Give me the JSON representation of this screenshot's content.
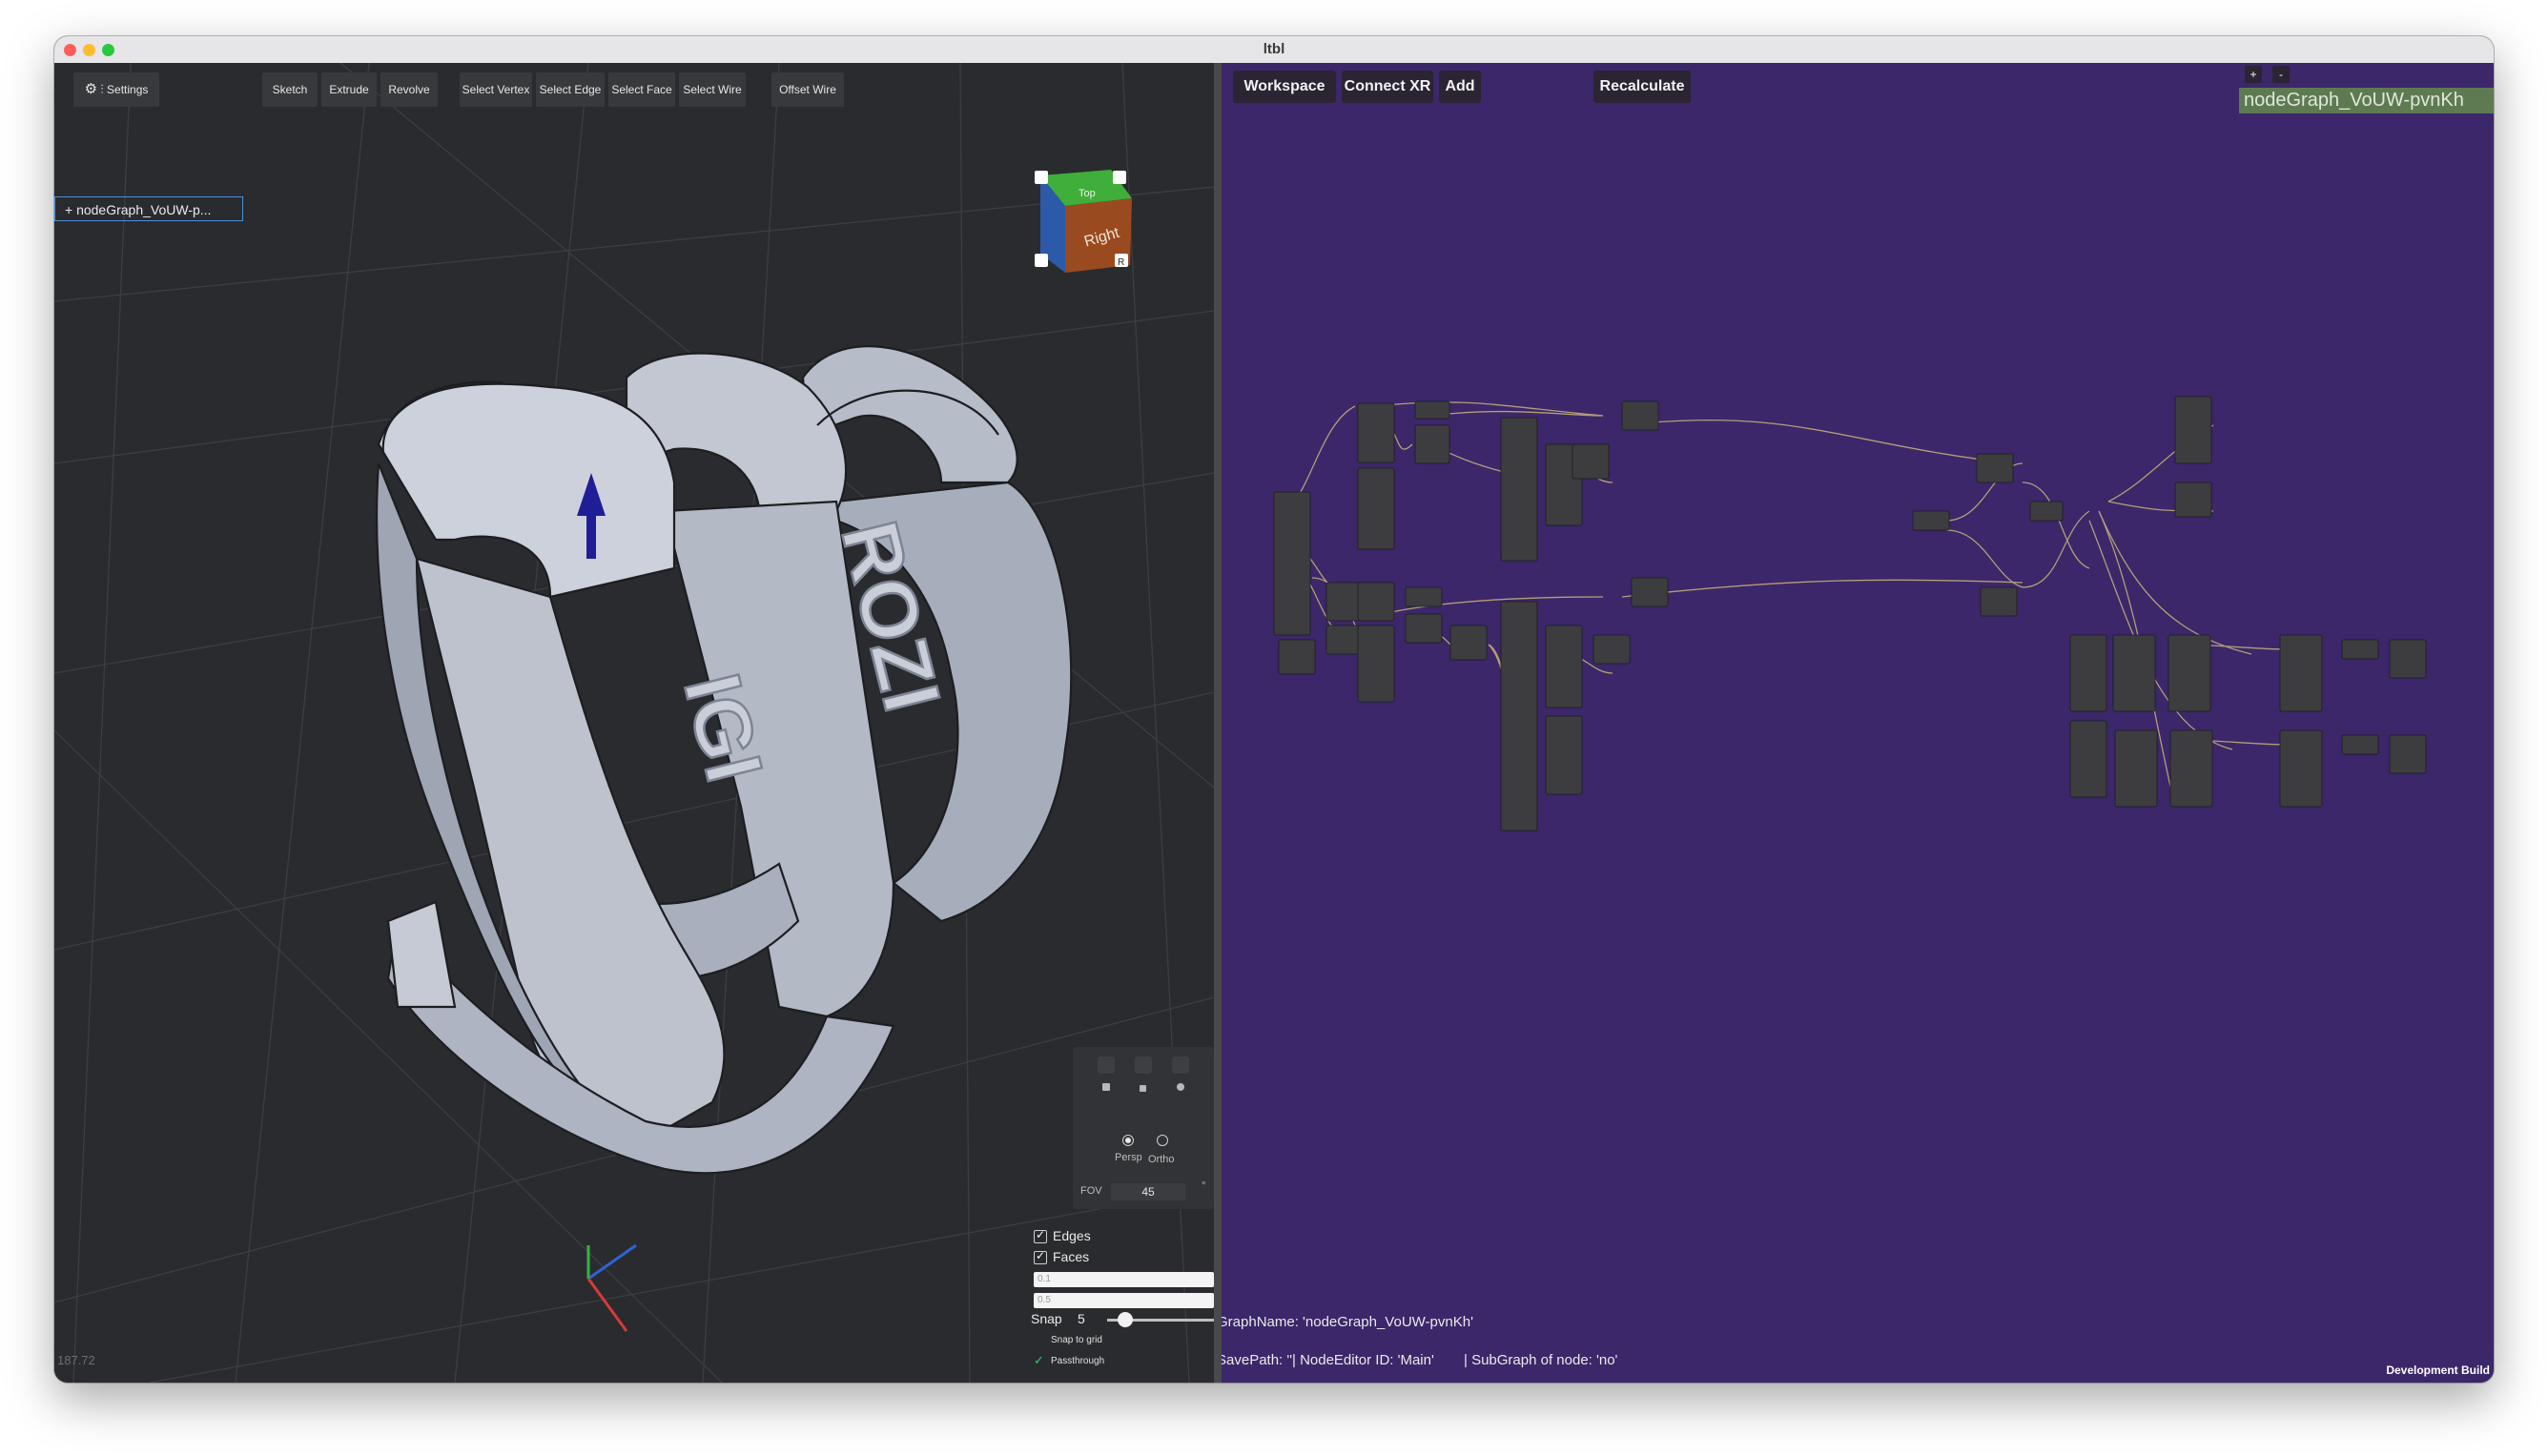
{
  "window": {
    "title": "ltbl"
  },
  "viewport": {
    "toolbar": {
      "settings": "Settings",
      "sketch": "Sketch",
      "extrude": "Extrude",
      "revolve": "Revolve",
      "select_vertex": "Select Vertex",
      "select_edge": "Select Edge",
      "select_face": "Select Face",
      "select_wire": "Select Wire",
      "offset_wire": "Offset Wire"
    },
    "node_tab": "+  nodeGraph_VoUW-p...",
    "view_cube": {
      "top": "Top",
      "right": "Right",
      "corner": "R"
    },
    "model_text": {
      "left": "IGI",
      "right": "ROZI"
    },
    "coordinate": "187.72",
    "camera": {
      "persp": "Persp",
      "ortho": "Ortho",
      "fov_label": "FOV",
      "fov_value": "45",
      "fov_unit": "°",
      "mode": "Persp"
    },
    "display": {
      "edges_label": "Edges",
      "edges": true,
      "faces_label": "Faces",
      "faces": true,
      "field1": "0.1",
      "field2": "0.5",
      "snap_label": "Snap",
      "snap_value": "5",
      "snap_slider": 0.1,
      "snap_to_grid_label": "Snap to grid",
      "snap_to_grid": false,
      "passthrough_label": "Passthrough",
      "passthrough": true
    }
  },
  "node_editor": {
    "buttons": {
      "workspace": "Workspace",
      "connect_xr": "Connect XR",
      "add": "Add",
      "recalculate": "Recalculate",
      "plus": "+",
      "minus": "-"
    },
    "graph_name_field": "nodeGraph_VoUW-pvnKh",
    "status": {
      "graph_name": "GraphName: 'nodeGraph_VoUW-pvnKh'",
      "save_path": "SavePath: ''",
      "node_editor_id": "| NodeEditor ID: 'Main'",
      "subgraph": "| SubGraph of node: 'no'"
    },
    "footer": "Development Build"
  },
  "colors": {
    "node_bg": "#3b2769",
    "viewport_bg": "#2a2b2e",
    "graph_field": "#5e7a52",
    "accent": "#4a90d9"
  }
}
